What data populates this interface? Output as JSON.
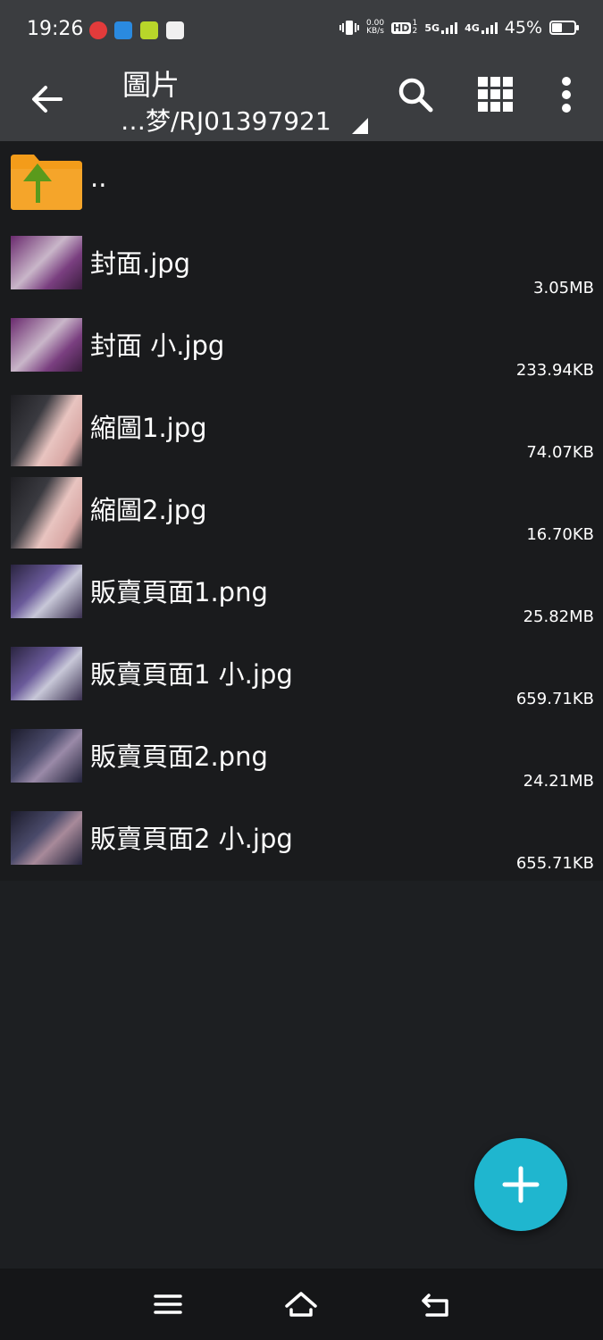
{
  "status_bar": {
    "time": "19:26",
    "net_speed_value": "0.00",
    "net_speed_unit": "KB/s",
    "hd_label": "HD",
    "hd_sub": "1 2",
    "signal1_label": "5G",
    "signal2_label": "4G",
    "battery": "45%",
    "battery_level": 0.45
  },
  "toolbar": {
    "title": "圖片",
    "path": "…梦/RJ01397921",
    "icons": [
      "back-arrow-icon",
      "search-icon",
      "grid-view-icon",
      "more-vert-icon"
    ]
  },
  "parent_entry": {
    "label": ".."
  },
  "files": [
    {
      "name": "封面.jpg",
      "size": "3.05MB"
    },
    {
      "name": "封面 小.jpg",
      "size": "233.94KB"
    },
    {
      "name": "縮圖1.jpg",
      "size": "74.07KB"
    },
    {
      "name": "縮圖2.jpg",
      "size": "16.70KB"
    },
    {
      "name": "販賣頁面1.png",
      "size": "25.82MB"
    },
    {
      "name": "販賣頁面1 小.jpg",
      "size": "659.71KB"
    },
    {
      "name": "販賣頁面2.png",
      "size": "24.21MB"
    },
    {
      "name": "販賣頁面2 小.jpg",
      "size": "655.71KB"
    }
  ],
  "colors": {
    "bar_bg": "#3b3d40",
    "list_bg": "#1a1b1d",
    "page_bg": "#1d1f22",
    "fab": "#1fb6cf",
    "folder": "#f39c1a",
    "folder_arrow": "#5a9a1c"
  }
}
